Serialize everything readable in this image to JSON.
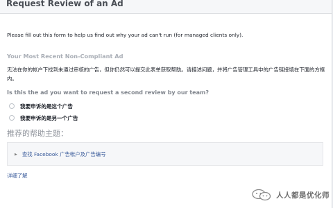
{
  "dialog": {
    "title": "Request Review of an Ad",
    "intro": "Please fill out this form to help us find out why your ad can't run (for managed clients only)."
  },
  "recent_ad": {
    "title": "Your Most Recent Non-Compliant Ad",
    "description": "无法在你的帐户下找到未通过审核的广告，但你仍然可以提交此表单获取帮助。请描述问题，并将广告管理工具中的广告链接填在下面的方框内。"
  },
  "question": {
    "text": "Is this the ad you want to request a second review by our team?",
    "options": [
      {
        "label": "我要申诉的是这个广告",
        "selected": false
      },
      {
        "label": "我要申诉的是另一个广告",
        "selected": false
      }
    ]
  },
  "help": {
    "title": "推荐的帮助主题：",
    "items": [
      {
        "label": "查找 Facebook 广告帐户及广告编号",
        "icon": "caret-right-icon"
      }
    ]
  },
  "footer": {
    "learn_more": "详细了解"
  },
  "watermark": {
    "text": "人人都是优化师",
    "icon": "wechat-logo"
  }
}
